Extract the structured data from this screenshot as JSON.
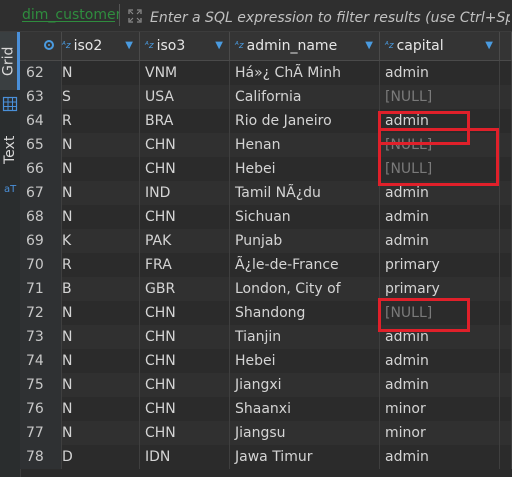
{
  "filter": {
    "table_tag": "dim_customers",
    "placeholder": "Enter a SQL expression to filter results (use Ctrl+Space)"
  },
  "side_tabs": {
    "grid": "Grid",
    "text": "Text"
  },
  "columns": [
    {
      "name": "iso2",
      "type_icon": "A-Z"
    },
    {
      "name": "iso3",
      "type_icon": "A-Z"
    },
    {
      "name": "admin_name",
      "type_icon": "A-Z"
    },
    {
      "name": "capital",
      "type_icon": "A-Z"
    }
  ],
  "rows": [
    {
      "num": "62",
      "iso2": "N",
      "iso3": "VNM",
      "admin_name": "Há»¿ ChÃ­ Minh",
      "capital": "admin"
    },
    {
      "num": "63",
      "iso2": "S",
      "iso3": "USA",
      "admin_name": "California",
      "capital": "[NULL]"
    },
    {
      "num": "64",
      "iso2": "R",
      "iso3": "BRA",
      "admin_name": "Rio de Janeiro",
      "capital": "admin"
    },
    {
      "num": "65",
      "iso2": "N",
      "iso3": "CHN",
      "admin_name": "Henan",
      "capital": "[NULL]"
    },
    {
      "num": "66",
      "iso2": "N",
      "iso3": "CHN",
      "admin_name": "Hebei",
      "capital": "[NULL]"
    },
    {
      "num": "67",
      "iso2": "N",
      "iso3": "IND",
      "admin_name": "Tamil NÃ¿du",
      "capital": "admin"
    },
    {
      "num": "68",
      "iso2": "N",
      "iso3": "CHN",
      "admin_name": "Sichuan",
      "capital": "admin"
    },
    {
      "num": "69",
      "iso2": "K",
      "iso3": "PAK",
      "admin_name": "Punjab",
      "capital": "admin"
    },
    {
      "num": "70",
      "iso2": "R",
      "iso3": "FRA",
      "admin_name": "Ã¿le-de-France",
      "capital": "primary"
    },
    {
      "num": "71",
      "iso2": "B",
      "iso3": "GBR",
      "admin_name": "London, City of",
      "capital": "primary"
    },
    {
      "num": "72",
      "iso2": "N",
      "iso3": "CHN",
      "admin_name": "Shandong",
      "capital": "[NULL]"
    },
    {
      "num": "73",
      "iso2": "N",
      "iso3": "CHN",
      "admin_name": "Tianjin",
      "capital": "admin"
    },
    {
      "num": "74",
      "iso2": "N",
      "iso3": "CHN",
      "admin_name": "Hebei",
      "capital": "admin"
    },
    {
      "num": "75",
      "iso2": "N",
      "iso3": "CHN",
      "admin_name": "Jiangxi",
      "capital": "admin"
    },
    {
      "num": "76",
      "iso2": "N",
      "iso3": "CHN",
      "admin_name": "Shaanxi",
      "capital": "minor"
    },
    {
      "num": "77",
      "iso2": "N",
      "iso3": "CHN",
      "admin_name": "Jiangsu",
      "capital": "minor"
    },
    {
      "num": "78",
      "iso2": "D",
      "iso3": "IDN",
      "admin_name": "Jawa Timur",
      "capital": "admin"
    }
  ],
  "colors": {
    "accent": "#4a90d9",
    "highlight": "#e0202a",
    "null_text": "#7a7a7a"
  }
}
